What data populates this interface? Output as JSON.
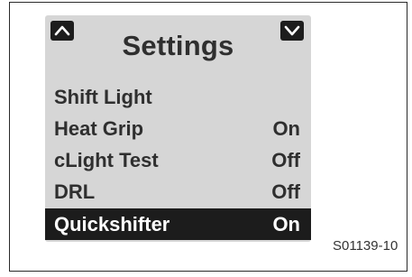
{
  "screen": {
    "title": "Settings",
    "nav": {
      "up_icon": "chevron-up-icon",
      "down_icon": "chevron-down-icon"
    },
    "items": [
      {
        "label": "Shift Light",
        "value": "",
        "selected": false
      },
      {
        "label": "Heat Grip",
        "value": "On",
        "selected": false
      },
      {
        "label": "cLight Test",
        "value": "Off",
        "selected": false
      },
      {
        "label": "DRL",
        "value": "Off",
        "selected": false
      },
      {
        "label": "Quickshifter",
        "value": "On",
        "selected": true
      }
    ],
    "colors": {
      "background": "#d6d6d6",
      "text": "#2f2f2f",
      "selected_bg": "#1c1c1c",
      "selected_text": "#ffffff"
    }
  },
  "figure_code": "S01139-10"
}
